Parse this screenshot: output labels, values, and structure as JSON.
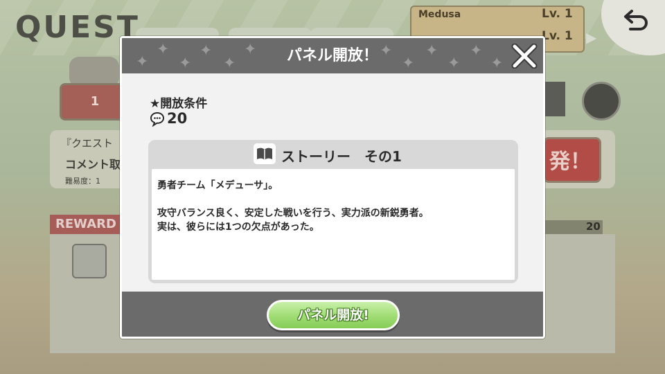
{
  "background": {
    "screen_title": "QUEST",
    "team_name": "Medusa",
    "team_level_1": "Lv. 1",
    "team_level_2": "Lv. 1",
    "stage_number": "1",
    "quest_name_partial": "『クエスト",
    "comment_partial": "コメント取",
    "difficulty": "難易度：1",
    "go_button_partial": "発！",
    "reward_label_partial": "REWARD",
    "count_value": "20"
  },
  "modal": {
    "title": "パネル開放！",
    "condition_label": "★開放条件",
    "condition_value": "20",
    "story_title": "ストーリー　その1",
    "story_text": "勇者チーム「メデューサ」。\n\n攻守バランス良く、安定した戦いを行う、実力派の新鋭勇者。\n実は、彼らには1つの欠点があった。",
    "open_button": "パネル開放!"
  },
  "colors": {
    "modal_header": "#6b6b6b",
    "open_button_green": "#9fdc73",
    "stage_red": "#a45f56"
  },
  "icons": [
    "close-icon",
    "speech-bubble-icon",
    "book-icon",
    "back-arrow-icon",
    "next-arrow-icon",
    "sparkle-icon"
  ]
}
